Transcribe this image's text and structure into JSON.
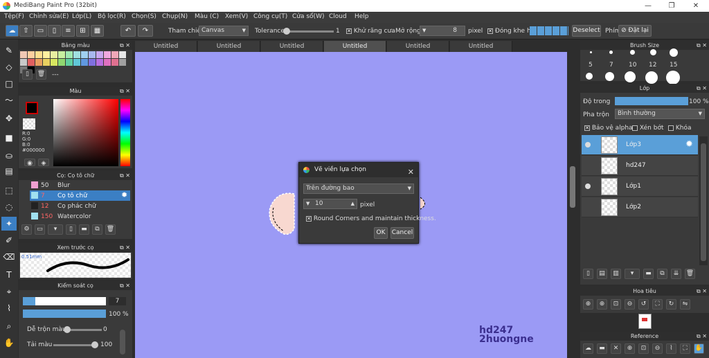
{
  "window": {
    "title": "MediBang Paint Pro (32bit)",
    "min": "—",
    "max": "❐",
    "close": "✕"
  },
  "menu": [
    "Tệp(F)",
    "Chỉnh sửa(E)",
    "Lớp(L)",
    "Bộ lọc(R)",
    "Chọn(S)",
    "Chụp(N)",
    "Màu (C)",
    "Xem(V)",
    "Công cụ(T)",
    "Cửa sổ(W)",
    "Cloud",
    "Help"
  ],
  "toolbar": {
    "ref_label": "Tham chiếu",
    "ref_value": "Canvas",
    "tolerance_label": "Tolerance",
    "tolerance_value": "1",
    "aa_label": "Khử răng cưa",
    "expand_label": "Mở rộng",
    "expand_value": "8",
    "expand_unit": "pixel",
    "gap_label": "Đóng khe hở",
    "deselect": "Deselect",
    "key_label": "Phím",
    "reset_label": "Đặt lại"
  },
  "tabs": [
    "Untitled",
    "Untitled",
    "Untitled",
    "Untitled",
    "Untitled",
    "Untitled"
  ],
  "palette_panel": {
    "title": "Bảng màu",
    "name": "---",
    "colors": [
      "#f0c8b4",
      "#ffd0a0",
      "#ffe090",
      "#fff0a0",
      "#e8f0a0",
      "#c8f0a0",
      "#a0e8b0",
      "#a0e0e0",
      "#a0d0f0",
      "#a8b8f0",
      "#c8a8f0",
      "#f0a8e0",
      "#f0a8b8",
      "#e8e8e8",
      "#c8c8c8",
      "#e06060",
      "#e8a060",
      "#e8d060",
      "#d8e860",
      "#90d870",
      "#60d0a0",
      "#60c8d8",
      "#6098e0",
      "#8070e0",
      "#b870e0",
      "#e070c0",
      "#e07090",
      "#a0a0a0",
      "#787878",
      "#000000"
    ]
  },
  "color_panel": {
    "title": "Màu",
    "r": "R:0",
    "g": "G:0",
    "b": "B:0",
    "hex": "#000000",
    "fg": "#000000",
    "bg": "#ffffff"
  },
  "brush_panel": {
    "title": "Cọ: Cọ tô chữ",
    "items": [
      {
        "size": "50",
        "name": "Blur",
        "color": "#f0a0d0"
      },
      {
        "size": "7",
        "name": "Cọ tô chữ",
        "color": "#a0e0f0"
      },
      {
        "size": "12",
        "name": "Cọ phác chữ",
        "color": "#222222"
      },
      {
        "size": "150",
        "name": "Watercolor",
        "color": "#a0e0f0"
      }
    ]
  },
  "preview_panel": {
    "title": "Xem trước cọ",
    "size": "0.51mm"
  },
  "brush_control": {
    "title": "Kiểm soát cọ",
    "size": "7",
    "opacity": "100 %",
    "size_fill": 0.15,
    "opacity_fill": 1.0,
    "blend_label": "Dễ trộn màu",
    "blend_value": "0",
    "blend_level": 0.0,
    "load_label": "Tải màu",
    "load_value": "100",
    "load_level": 1.0
  },
  "dialog": {
    "title": "Vẽ viền lựa chọn",
    "mode": "Trên đường bao",
    "width": "10",
    "unit": "pixel",
    "round_label": "Round Corners and maintain thickness.",
    "round_checked": "✕",
    "ok": "OK",
    "cancel": "Cancel"
  },
  "watermark": {
    "line1": "hd247",
    "line2": "2huongne",
    "color": "#3b2f8f"
  },
  "brush_size": {
    "title": "Brush Size",
    "sizes": [
      "5",
      "7",
      "10",
      "12",
      "15"
    ]
  },
  "layer_panel": {
    "title": "Lớp",
    "opacity_label": "Độ trong",
    "opacity_value": "100 %",
    "opacity_level": 1.0,
    "blend_label": "Pha trộn",
    "blend_value": "Bình thường",
    "protect_label": "Bảo vệ alpha",
    "clip_label": "Xén bớt",
    "lock_label": "Khóa",
    "layers": [
      {
        "name": "Lớp3",
        "active": true
      },
      {
        "name": "hd247",
        "active": false
      },
      {
        "name": "Lớp1",
        "active": false
      },
      {
        "name": "Lớp2",
        "active": false
      }
    ]
  },
  "navigator": {
    "title": "Hoa tiêu"
  },
  "reference": {
    "title": "Reference"
  },
  "colors": {
    "accent": "#3b7fc4",
    "canvas": "#9b9af5",
    "panel": "#3a3a3a"
  }
}
